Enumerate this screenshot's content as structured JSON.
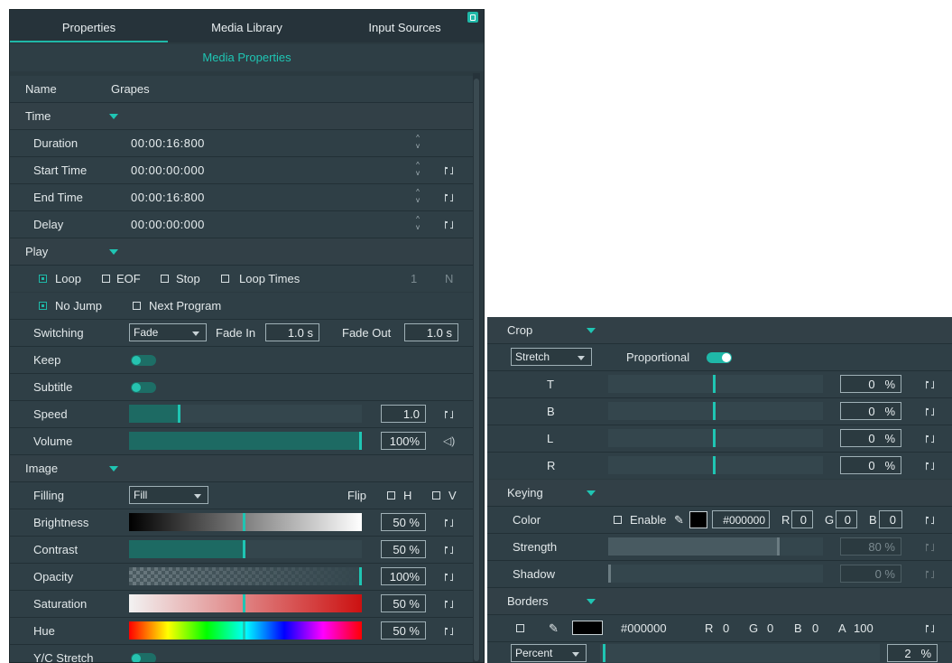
{
  "tabs": [
    "Properties",
    "Media Library",
    "Input Sources"
  ],
  "subheader": "Media Properties",
  "name_label": "Name",
  "name_value": "Grapes",
  "time": {
    "title": "Time",
    "rows": [
      {
        "label": "Duration",
        "value": "00:00:16:800"
      },
      {
        "label": "Start Time",
        "value": "00:00:00:000"
      },
      {
        "label": "End Time",
        "value": "00:00:16:800"
      },
      {
        "label": "Delay",
        "value": "00:00:00:000"
      }
    ]
  },
  "play": {
    "title": "Play",
    "loop": "Loop",
    "eof": "EOF",
    "stop": "Stop",
    "loop_times": "Loop Times",
    "loop_count": "1",
    "loop_n": "N",
    "no_jump": "No Jump",
    "next_program": "Next Program",
    "switching_label": "Switching",
    "switching_value": "Fade",
    "fade_in_label": "Fade In",
    "fade_in_value": "1.0  s",
    "fade_out_label": "Fade Out",
    "fade_out_value": "1.0  s",
    "keep_label": "Keep",
    "subtitle_label": "Subtitle",
    "speed_label": "Speed",
    "speed_value": "1.0",
    "speed_level": 0.22,
    "volume_label": "Volume",
    "volume_value": "100%",
    "volume_level": 1.0
  },
  "image": {
    "title": "Image",
    "filling_label": "Filling",
    "filling_value": "Fill",
    "flip_label": "Flip",
    "flip_h": "H",
    "flip_v": "V",
    "rows": [
      {
        "label": "Brightness",
        "value": "50 %",
        "level": 0.5
      },
      {
        "label": "Contrast",
        "value": "50 %",
        "level": 0.5
      },
      {
        "label": "Opacity",
        "value": "100%",
        "level": 1.0
      },
      {
        "label": "Saturation",
        "value": "50 %",
        "level": 0.5
      },
      {
        "label": "Hue",
        "value": "50 %",
        "level": 0.5
      }
    ],
    "yc_label": "Y/C Stretch"
  },
  "crop": {
    "title": "Crop",
    "mode": "Stretch",
    "proportional": "Proportional",
    "rows": [
      {
        "label": "T",
        "value": "0",
        "unit": "%",
        "level": 0.5
      },
      {
        "label": "B",
        "value": "0",
        "unit": "%",
        "level": 0.5
      },
      {
        "label": "L",
        "value": "0",
        "unit": "%",
        "level": 0.5
      },
      {
        "label": "R",
        "value": "0",
        "unit": "%",
        "level": 0.5
      }
    ]
  },
  "keying": {
    "title": "Keying",
    "color_label": "Color",
    "enable": "Enable",
    "hex": "#000000",
    "r_label": "R",
    "r": "0",
    "g_label": "G",
    "g": "0",
    "b_label": "B",
    "b": "0",
    "strength_label": "Strength",
    "strength_value": "80 %",
    "strength_level": 0.8,
    "shadow_label": "Shadow",
    "shadow_value": "0 %",
    "shadow_level": 0.0
  },
  "borders": {
    "title": "Borders",
    "hex": "#000000",
    "r_label": "R",
    "r": "0",
    "g_label": "G",
    "g": "0",
    "b_label": "B",
    "b": "0",
    "a_label": "A",
    "a": "100",
    "mode": "Percent",
    "value": "2",
    "unit": "%",
    "level": 0.02
  },
  "colors": {
    "accent": "#1fb8a8",
    "panel": "#2b3a40"
  }
}
